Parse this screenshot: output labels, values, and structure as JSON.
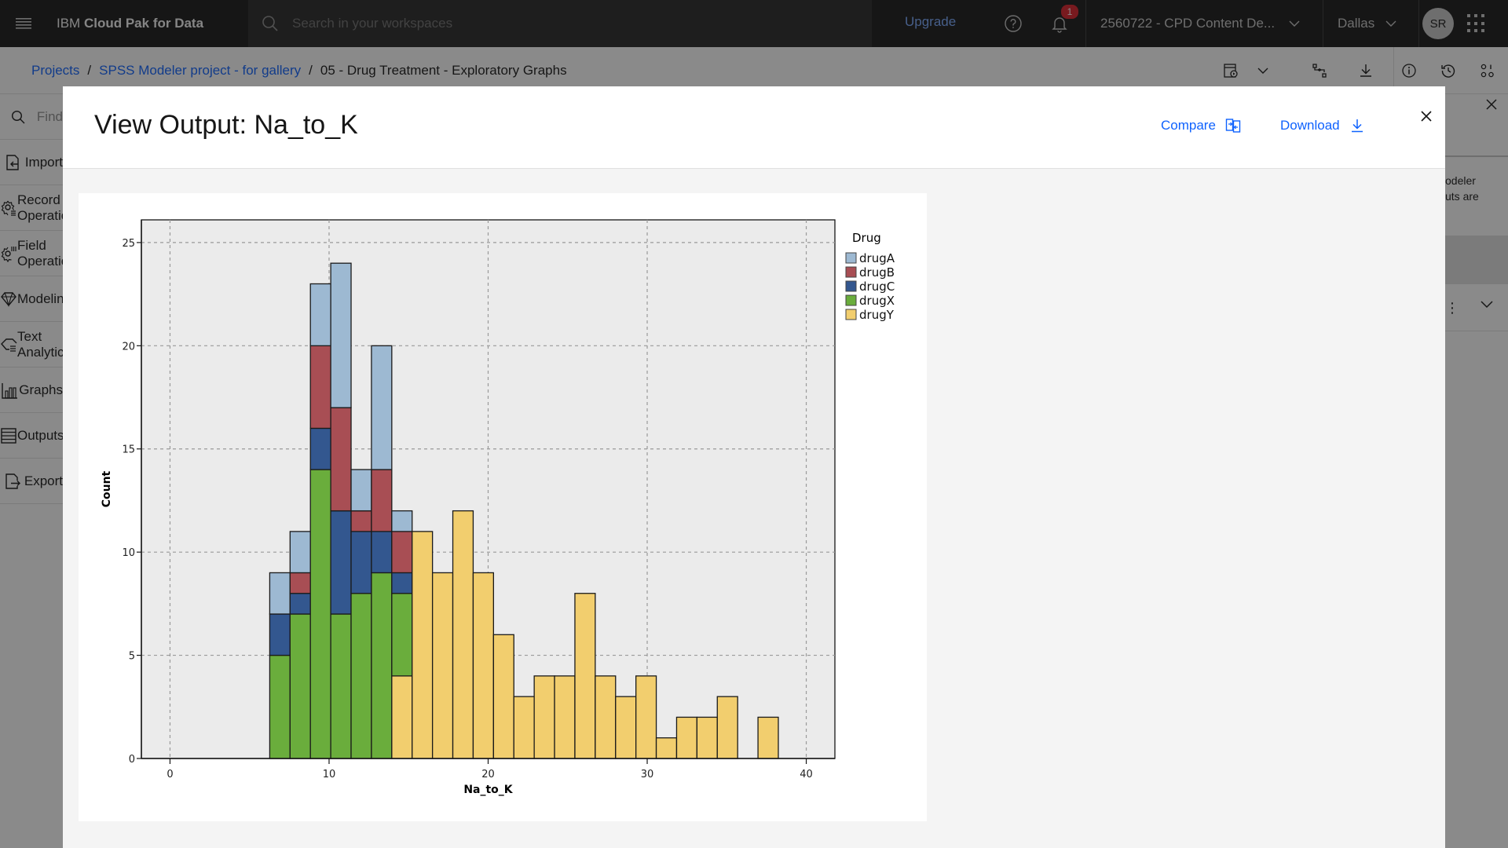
{
  "topbar": {
    "brand_prefix": "IBM",
    "brand_name": "Cloud Pak for Data",
    "search_placeholder": "Search in your workspaces",
    "upgrade_label": "Upgrade",
    "notification_count": "1",
    "account_label": "2560722 - CPD Content De...",
    "region_label": "Dallas",
    "avatar_initials": "SR"
  },
  "breadcrumb": {
    "items": [
      {
        "label": "Projects"
      },
      {
        "label": "SPSS Modeler project - for gallery"
      }
    ],
    "current": "05 - Drug Treatment - Exploratory Graphs",
    "separator": "/"
  },
  "palette": {
    "search_placeholder": "Find",
    "items": [
      {
        "label": "Import",
        "icon": "import-icon"
      },
      {
        "label": "Record Operations",
        "icon": "record-ops-icon"
      },
      {
        "label": "Field Operations",
        "icon": "field-ops-icon"
      },
      {
        "label": "Modeling",
        "icon": "diamond-icon"
      },
      {
        "label": "Text Analytics",
        "icon": "text-analytics-icon"
      },
      {
        "label": "Graphs",
        "icon": "chart-icon"
      },
      {
        "label": "Outputs",
        "icon": "table-icon"
      },
      {
        "label": "Export",
        "icon": "export-icon"
      }
    ]
  },
  "right_panel": {
    "text_line1": "odeler",
    "text_line2": "uts are"
  },
  "modal": {
    "title": "View Output: Na_to_K",
    "compare_label": "Compare",
    "download_label": "Download"
  },
  "chart_data": {
    "type": "bar",
    "stacked": true,
    "title": "",
    "xlabel": "Na_to_K",
    "ylabel": "Count",
    "xlim": [
      -1.8,
      41.8
    ],
    "ylim": [
      0,
      26.1
    ],
    "x_ticks": [
      0,
      10,
      20,
      30,
      40
    ],
    "y_ticks": [
      0,
      5,
      10,
      15,
      20,
      25
    ],
    "grid": true,
    "legend_title": "Drug",
    "legend_position": "right",
    "bin_start": 6.269,
    "bin_width": 1.279,
    "bins": 25,
    "series": [
      {
        "name": "drugY",
        "color": "#f2ce6e",
        "values": [
          0,
          0,
          0,
          0,
          0,
          0,
          4,
          11,
          9,
          12,
          9,
          6,
          3,
          4,
          4,
          8,
          4,
          3,
          4,
          1,
          2,
          2,
          3,
          0,
          2
        ]
      },
      {
        "name": "drugX",
        "color": "#6aad3c",
        "values": [
          5,
          7,
          14,
          7,
          8,
          9,
          4,
          0,
          0,
          0,
          0,
          0,
          0,
          0,
          0,
          0,
          0,
          0,
          0,
          0,
          0,
          0,
          0,
          0,
          0
        ]
      },
      {
        "name": "drugC",
        "color": "#33578f",
        "values": [
          2,
          1,
          2,
          5,
          3,
          2,
          1,
          0,
          0,
          0,
          0,
          0,
          0,
          0,
          0,
          0,
          0,
          0,
          0,
          0,
          0,
          0,
          0,
          0,
          0
        ]
      },
      {
        "name": "drugB",
        "color": "#a84e54",
        "values": [
          0,
          1,
          4,
          5,
          1,
          3,
          2,
          0,
          0,
          0,
          0,
          0,
          0,
          0,
          0,
          0,
          0,
          0,
          0,
          0,
          0,
          0,
          0,
          0,
          0
        ]
      },
      {
        "name": "drugA",
        "color": "#9db9d2",
        "values": [
          2,
          2,
          3,
          7,
          2,
          6,
          1,
          0,
          0,
          0,
          0,
          0,
          0,
          0,
          0,
          0,
          0,
          0,
          0,
          0,
          0,
          0,
          0,
          0,
          0
        ]
      }
    ],
    "legend_order": [
      "drugA",
      "drugB",
      "drugC",
      "drugX",
      "drugY"
    ]
  }
}
